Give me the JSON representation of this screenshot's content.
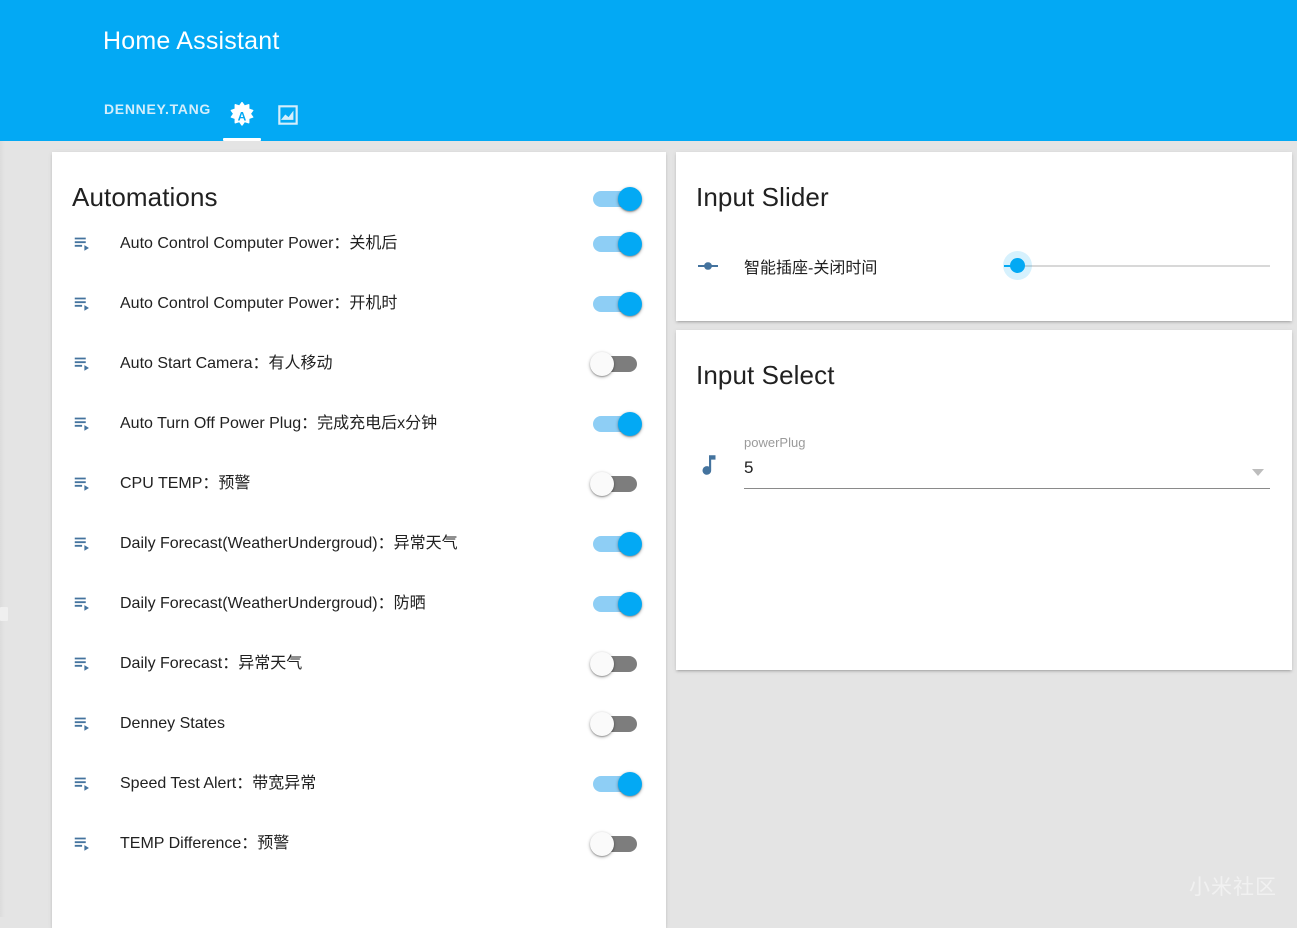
{
  "app": {
    "title": "Home Assistant",
    "accent_color": "#03a9f4",
    "background_color": "#e4e4e4"
  },
  "tabs": [
    {
      "label": "DENNEY.TANG",
      "icon": "text-tab",
      "active": false
    },
    {
      "label": "",
      "icon": "brightness-auto-icon",
      "active": true
    },
    {
      "label": "",
      "icon": "chart-line-icon",
      "active": false
    }
  ],
  "automations_card": {
    "title": "Automations",
    "master_toggle": {
      "state": "on",
      "label": "Automations master toggle"
    },
    "row_icon": "playlist-play-icon",
    "rows": [
      {
        "label": "Auto Control Computer Power：关机后",
        "state": "on"
      },
      {
        "label": "Auto Control Computer Power：开机时",
        "state": "on"
      },
      {
        "label": "Auto Start Camera：有人移动",
        "state": "off"
      },
      {
        "label": "Auto Turn Off Power Plug：完成充电后x分钟",
        "state": "on"
      },
      {
        "label": "CPU TEMP：预警",
        "state": "off"
      },
      {
        "label": "Daily Forecast(WeatherUndergroud)：异常天气",
        "state": "on"
      },
      {
        "label": "Daily Forecast(WeatherUndergroud)：防晒",
        "state": "on"
      },
      {
        "label": "Daily Forecast：异常天气",
        "state": "off"
      },
      {
        "label": "Denney States",
        "state": "off"
      },
      {
        "label": "Speed Test Alert：带宽异常",
        "state": "on"
      },
      {
        "label": "TEMP Difference：预警",
        "state": "off"
      }
    ]
  },
  "input_slider_card": {
    "title": "Input Slider",
    "icon": "ray-vertex-icon",
    "label": "智能插座-关闭时间",
    "value_percent": 5
  },
  "input_select_card": {
    "title": "Input Select",
    "icon": "music-note-icon",
    "field_label": "powerPlug",
    "selected_value": "5",
    "dropdown_icon": "chevron-down-icon"
  },
  "watermark": {
    "text": "小米社区"
  }
}
